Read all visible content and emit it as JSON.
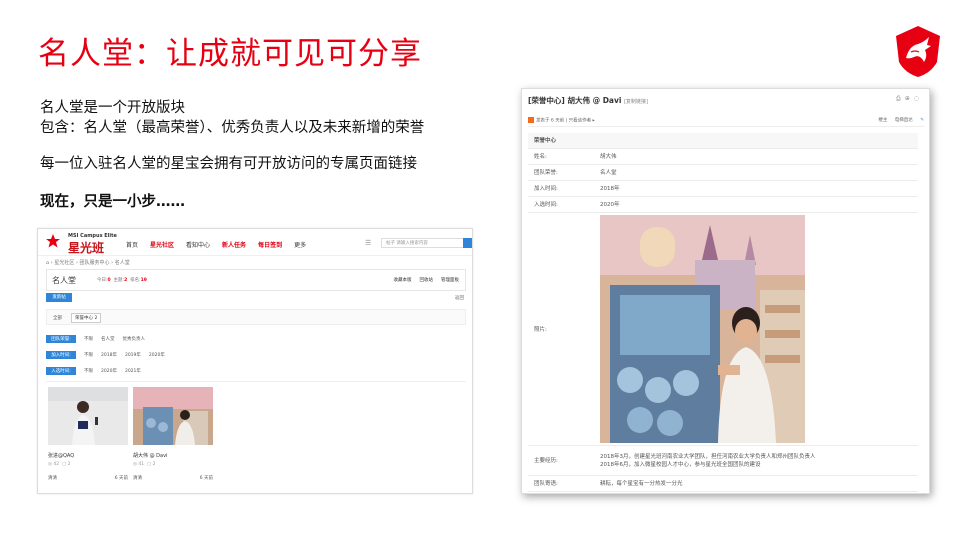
{
  "slide": {
    "title": "名人堂：让成就可见可分享",
    "intro": {
      "line1": "名人堂是一个开放版块",
      "line2": "包含：名人堂（最高荣誉）、优秀负责人以及未来新增的荣誉",
      "line3": "每一位入驻名人堂的星宝会拥有可开放访问的专属页面链接",
      "line4": "现在，只是一小步……"
    },
    "logo_icon": "msi-dragon-shield-icon",
    "accent_color": "#e60012"
  },
  "forum": {
    "brand_sub": "MSI Campus Elite",
    "brand": "星光班",
    "nav": [
      "首页",
      "星光社区",
      "看知中心",
      "新人任务",
      "每日签到",
      "更多"
    ],
    "search_placeholder": "帖子 请输入搜索内容",
    "breadcrumb": "⌂ › 星光社区 › 团队服务中心 › 名人堂",
    "board_title": "名人堂",
    "board_stats": {
      "today_label": "今日:",
      "today": "0",
      "topic_label": "主题:",
      "topic": "2",
      "rank_label": "排名:",
      "rank": "19"
    },
    "board_links": [
      "收藏本版",
      "回收站",
      "管理面板"
    ],
    "post_button": "发新帖",
    "return_link": "返回",
    "tabs": {
      "all": "全部",
      "current": "荣誉中心",
      "count": "2"
    },
    "filters": [
      {
        "label": "团队荣誉:",
        "options": [
          "不限",
          "名人堂",
          "优秀负责人"
        ]
      },
      {
        "label": "加入时间:",
        "options": [
          "不限",
          "2018年",
          "2019年",
          "2020年"
        ]
      },
      {
        "label": "入选时间:",
        "options": [
          "不限",
          "2020年",
          "2021年"
        ]
      }
    ],
    "cards": [
      {
        "name": "张进@QAQ",
        "views": "42",
        "replies": "2",
        "user": "清清",
        "time": "6 天前"
      },
      {
        "name": "胡大伟 @ Davi",
        "views": "41",
        "replies": "2",
        "user": "清清",
        "time": "6 天前"
      }
    ]
  },
  "detail": {
    "title": "[荣誉中心] 胡大伟 @ Davi",
    "copy_link": "[复制链接]",
    "posted": "发表于 6 天前",
    "only_author": "只看该作者",
    "right_links": [
      "楼主",
      "电梯直达"
    ],
    "section": "荣誉中心",
    "rows": [
      {
        "k": "姓名:",
        "v": "胡大伟"
      },
      {
        "k": "团队荣誉:",
        "v": "名人堂"
      },
      {
        "k": "加入时间:",
        "v": "2018年"
      },
      {
        "k": "入选时间:",
        "v": "2020年"
      }
    ],
    "photo_label": "照片:",
    "experience_label": "主要经历:",
    "experience": [
      "2018年3月，创建星光班河南农业大学团队，担任河南农业大学负责人和郑州团队负责人",
      "2018年6月，加入微星校园人才中心，参与星光班全国团队的建设"
    ],
    "message_label": "团队寄语:",
    "message": "耕耘，每个星宝有一分热发一分光"
  }
}
